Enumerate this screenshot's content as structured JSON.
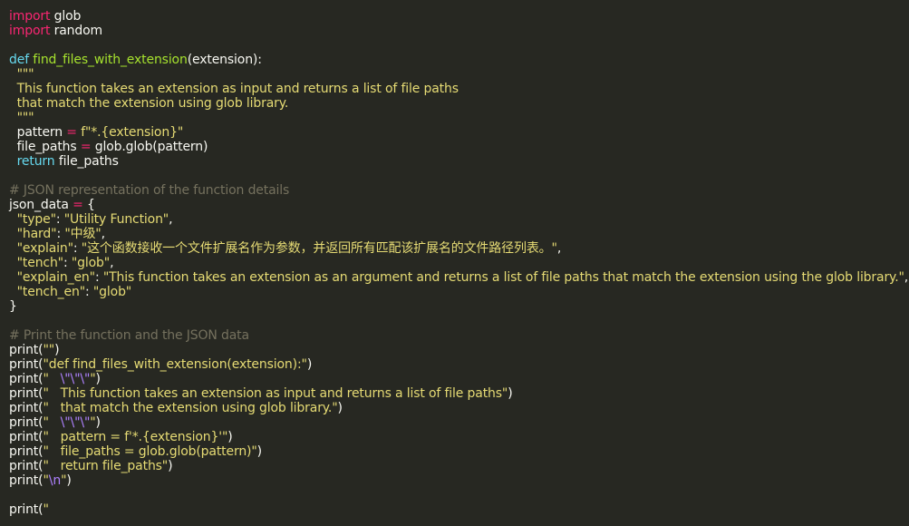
{
  "lines": [
    [
      {
        "t": "import",
        "c": "kw"
      },
      {
        "t": " glob",
        "c": "pl"
      }
    ],
    [
      {
        "t": "import",
        "c": "kw"
      },
      {
        "t": " random",
        "c": "pl"
      }
    ],
    [],
    [
      {
        "t": "def",
        "c": "kw2"
      },
      {
        "t": " ",
        "c": "pl"
      },
      {
        "t": "find_files_with_extension",
        "c": "fn"
      },
      {
        "t": "(extension):",
        "c": "pl"
      }
    ],
    [
      {
        "t": "  \"\"\"",
        "c": "str"
      }
    ],
    [
      {
        "t": "  This function takes an extension as input and returns a list of file paths",
        "c": "str"
      }
    ],
    [
      {
        "t": "  that match the extension using glob library.",
        "c": "str"
      }
    ],
    [
      {
        "t": "  \"\"\"",
        "c": "str"
      }
    ],
    [
      {
        "t": "  pattern ",
        "c": "pl"
      },
      {
        "t": "=",
        "c": "op"
      },
      {
        "t": " f\"*.{extension}\"",
        "c": "str"
      }
    ],
    [
      {
        "t": "  file_paths ",
        "c": "pl"
      },
      {
        "t": "=",
        "c": "op"
      },
      {
        "t": " glob.glob(pattern)",
        "c": "pl"
      }
    ],
    [
      {
        "t": "  ",
        "c": "pl"
      },
      {
        "t": "return",
        "c": "kw2"
      },
      {
        "t": " file_paths",
        "c": "pl"
      }
    ],
    [],
    [
      {
        "t": "# JSON representation of the function details",
        "c": "cm"
      }
    ],
    [
      {
        "t": "json_data ",
        "c": "pl"
      },
      {
        "t": "=",
        "c": "op"
      },
      {
        "t": " {",
        "c": "pl"
      }
    ],
    [
      {
        "t": "  \"type\"",
        "c": "str"
      },
      {
        "t": ": ",
        "c": "pl"
      },
      {
        "t": "\"Utility Function\"",
        "c": "str"
      },
      {
        "t": ",",
        "c": "pl"
      }
    ],
    [
      {
        "t": "  \"hard\"",
        "c": "str"
      },
      {
        "t": ": ",
        "c": "pl"
      },
      {
        "t": "\"中级\"",
        "c": "str"
      },
      {
        "t": ",",
        "c": "pl"
      }
    ],
    [
      {
        "t": "  \"explain\"",
        "c": "str"
      },
      {
        "t": ": ",
        "c": "pl"
      },
      {
        "t": "\"这个函数接收一个文件扩展名作为参数，并返回所有匹配该扩展名的文件路径列表。\"",
        "c": "str"
      },
      {
        "t": ",",
        "c": "pl"
      }
    ],
    [
      {
        "t": "  \"tench\"",
        "c": "str"
      },
      {
        "t": ": ",
        "c": "pl"
      },
      {
        "t": "\"glob\"",
        "c": "str"
      },
      {
        "t": ",",
        "c": "pl"
      }
    ],
    [
      {
        "t": "  \"explain_en\"",
        "c": "str"
      },
      {
        "t": ": ",
        "c": "pl"
      },
      {
        "t": "\"This function takes an extension as an argument and returns a list of file paths that match the extension using the glob library.\"",
        "c": "str"
      },
      {
        "t": ",",
        "c": "pl"
      }
    ],
    [
      {
        "t": "  \"tench_en\"",
        "c": "str"
      },
      {
        "t": ": ",
        "c": "pl"
      },
      {
        "t": "\"glob\"",
        "c": "str"
      }
    ],
    [
      {
        "t": "}",
        "c": "pl"
      }
    ],
    [],
    [
      {
        "t": "# Print the function and the JSON data",
        "c": "cm"
      }
    ],
    [
      {
        "t": "print(",
        "c": "pl"
      },
      {
        "t": "\"\"",
        "c": "str"
      },
      {
        "t": ")",
        "c": "pl"
      }
    ],
    [
      {
        "t": "print(",
        "c": "pl"
      },
      {
        "t": "\"def find_files_with_extension(extension):\"",
        "c": "str"
      },
      {
        "t": ")",
        "c": "pl"
      }
    ],
    [
      {
        "t": "print(",
        "c": "pl"
      },
      {
        "t": "\"   ",
        "c": "str"
      },
      {
        "t": "\\\"\\\"\\\"",
        "c": "esc"
      },
      {
        "t": "\"",
        "c": "str"
      },
      {
        "t": ")",
        "c": "pl"
      }
    ],
    [
      {
        "t": "print(",
        "c": "pl"
      },
      {
        "t": "\"   This function takes an extension as input and returns a list of file paths\"",
        "c": "str"
      },
      {
        "t": ")",
        "c": "pl"
      }
    ],
    [
      {
        "t": "print(",
        "c": "pl"
      },
      {
        "t": "\"   that match the extension using glob library.\"",
        "c": "str"
      },
      {
        "t": ")",
        "c": "pl"
      }
    ],
    [
      {
        "t": "print(",
        "c": "pl"
      },
      {
        "t": "\"   ",
        "c": "str"
      },
      {
        "t": "\\\"\\\"\\\"",
        "c": "esc"
      },
      {
        "t": "\"",
        "c": "str"
      },
      {
        "t": ")",
        "c": "pl"
      }
    ],
    [
      {
        "t": "print(",
        "c": "pl"
      },
      {
        "t": "\"   pattern = f'*.{extension}'\"",
        "c": "str"
      },
      {
        "t": ")",
        "c": "pl"
      }
    ],
    [
      {
        "t": "print(",
        "c": "pl"
      },
      {
        "t": "\"   file_paths = glob.glob(pattern)\"",
        "c": "str"
      },
      {
        "t": ")",
        "c": "pl"
      }
    ],
    [
      {
        "t": "print(",
        "c": "pl"
      },
      {
        "t": "\"   return file_paths\"",
        "c": "str"
      },
      {
        "t": ")",
        "c": "pl"
      }
    ],
    [
      {
        "t": "print(",
        "c": "pl"
      },
      {
        "t": "\"",
        "c": "str"
      },
      {
        "t": "\\n",
        "c": "esc"
      },
      {
        "t": "\"",
        "c": "str"
      },
      {
        "t": ")",
        "c": "pl"
      }
    ],
    [],
    [
      {
        "t": "print(",
        "c": "pl"
      },
      {
        "t": "\"",
        "c": "str"
      }
    ]
  ],
  "colors": {
    "background": "#272822",
    "keyword": "#f92672",
    "storage": "#66d9ef",
    "function": "#a6e22e",
    "string": "#e6db74",
    "comment": "#75715e",
    "escape": "#ae81ff",
    "text": "#f8f8f2"
  }
}
